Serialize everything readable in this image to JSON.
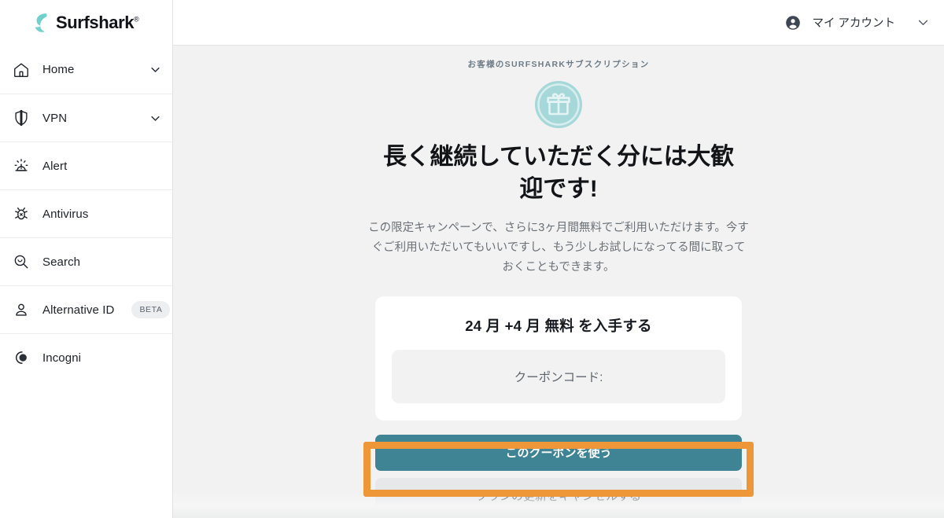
{
  "brand": {
    "name": "Surfshark",
    "registered_mark": "®",
    "logo_icon": "surfshark-logo-icon",
    "accent_teal": "#3e8494",
    "logo_teal": "#6fd0cc"
  },
  "sidebar": {
    "items": [
      {
        "label": "Home",
        "icon": "home-icon",
        "chevron": true,
        "badge": null
      },
      {
        "label": "VPN",
        "icon": "shield-icon",
        "chevron": true,
        "badge": null
      },
      {
        "label": "Alert",
        "icon": "alert-siren-icon",
        "chevron": false,
        "badge": null
      },
      {
        "label": "Antivirus",
        "icon": "bug-icon",
        "chevron": false,
        "badge": null
      },
      {
        "label": "Search",
        "icon": "search-icon",
        "chevron": false,
        "badge": null
      },
      {
        "label": "Alternative ID",
        "icon": "person-icon",
        "chevron": false,
        "badge": "BETA"
      },
      {
        "label": "Incogni",
        "icon": "incogni-icon",
        "chevron": false,
        "badge": null
      }
    ]
  },
  "topbar": {
    "account_label": "マイ アカウント",
    "account_icon": "account-circle-icon",
    "chevron_icon": "chevron-down-icon"
  },
  "main": {
    "eyebrow": "お客様のSURFSHARKサブスクリプション",
    "gift_icon": "gift-icon",
    "headline": "長く継続していただく分には大歓迎です!",
    "subtext": "この限定キャンペーンで、さらに3ヶ月間無料でご利用いただけます。今すぐご利用いただいてもいいですし、もう少しお試しになってる間に取っておくこともできます。",
    "offer": {
      "title": "24 月 +4 月 無料 を入手する",
      "coupon_label": "クーポンコード:",
      "coupon_value": ""
    },
    "primary_button": "このクーポンを使う",
    "secondary_button": "プランの更新をキャンセルする"
  },
  "annotation": {
    "highlight_color": "#ed9739",
    "target": "secondary_button"
  }
}
